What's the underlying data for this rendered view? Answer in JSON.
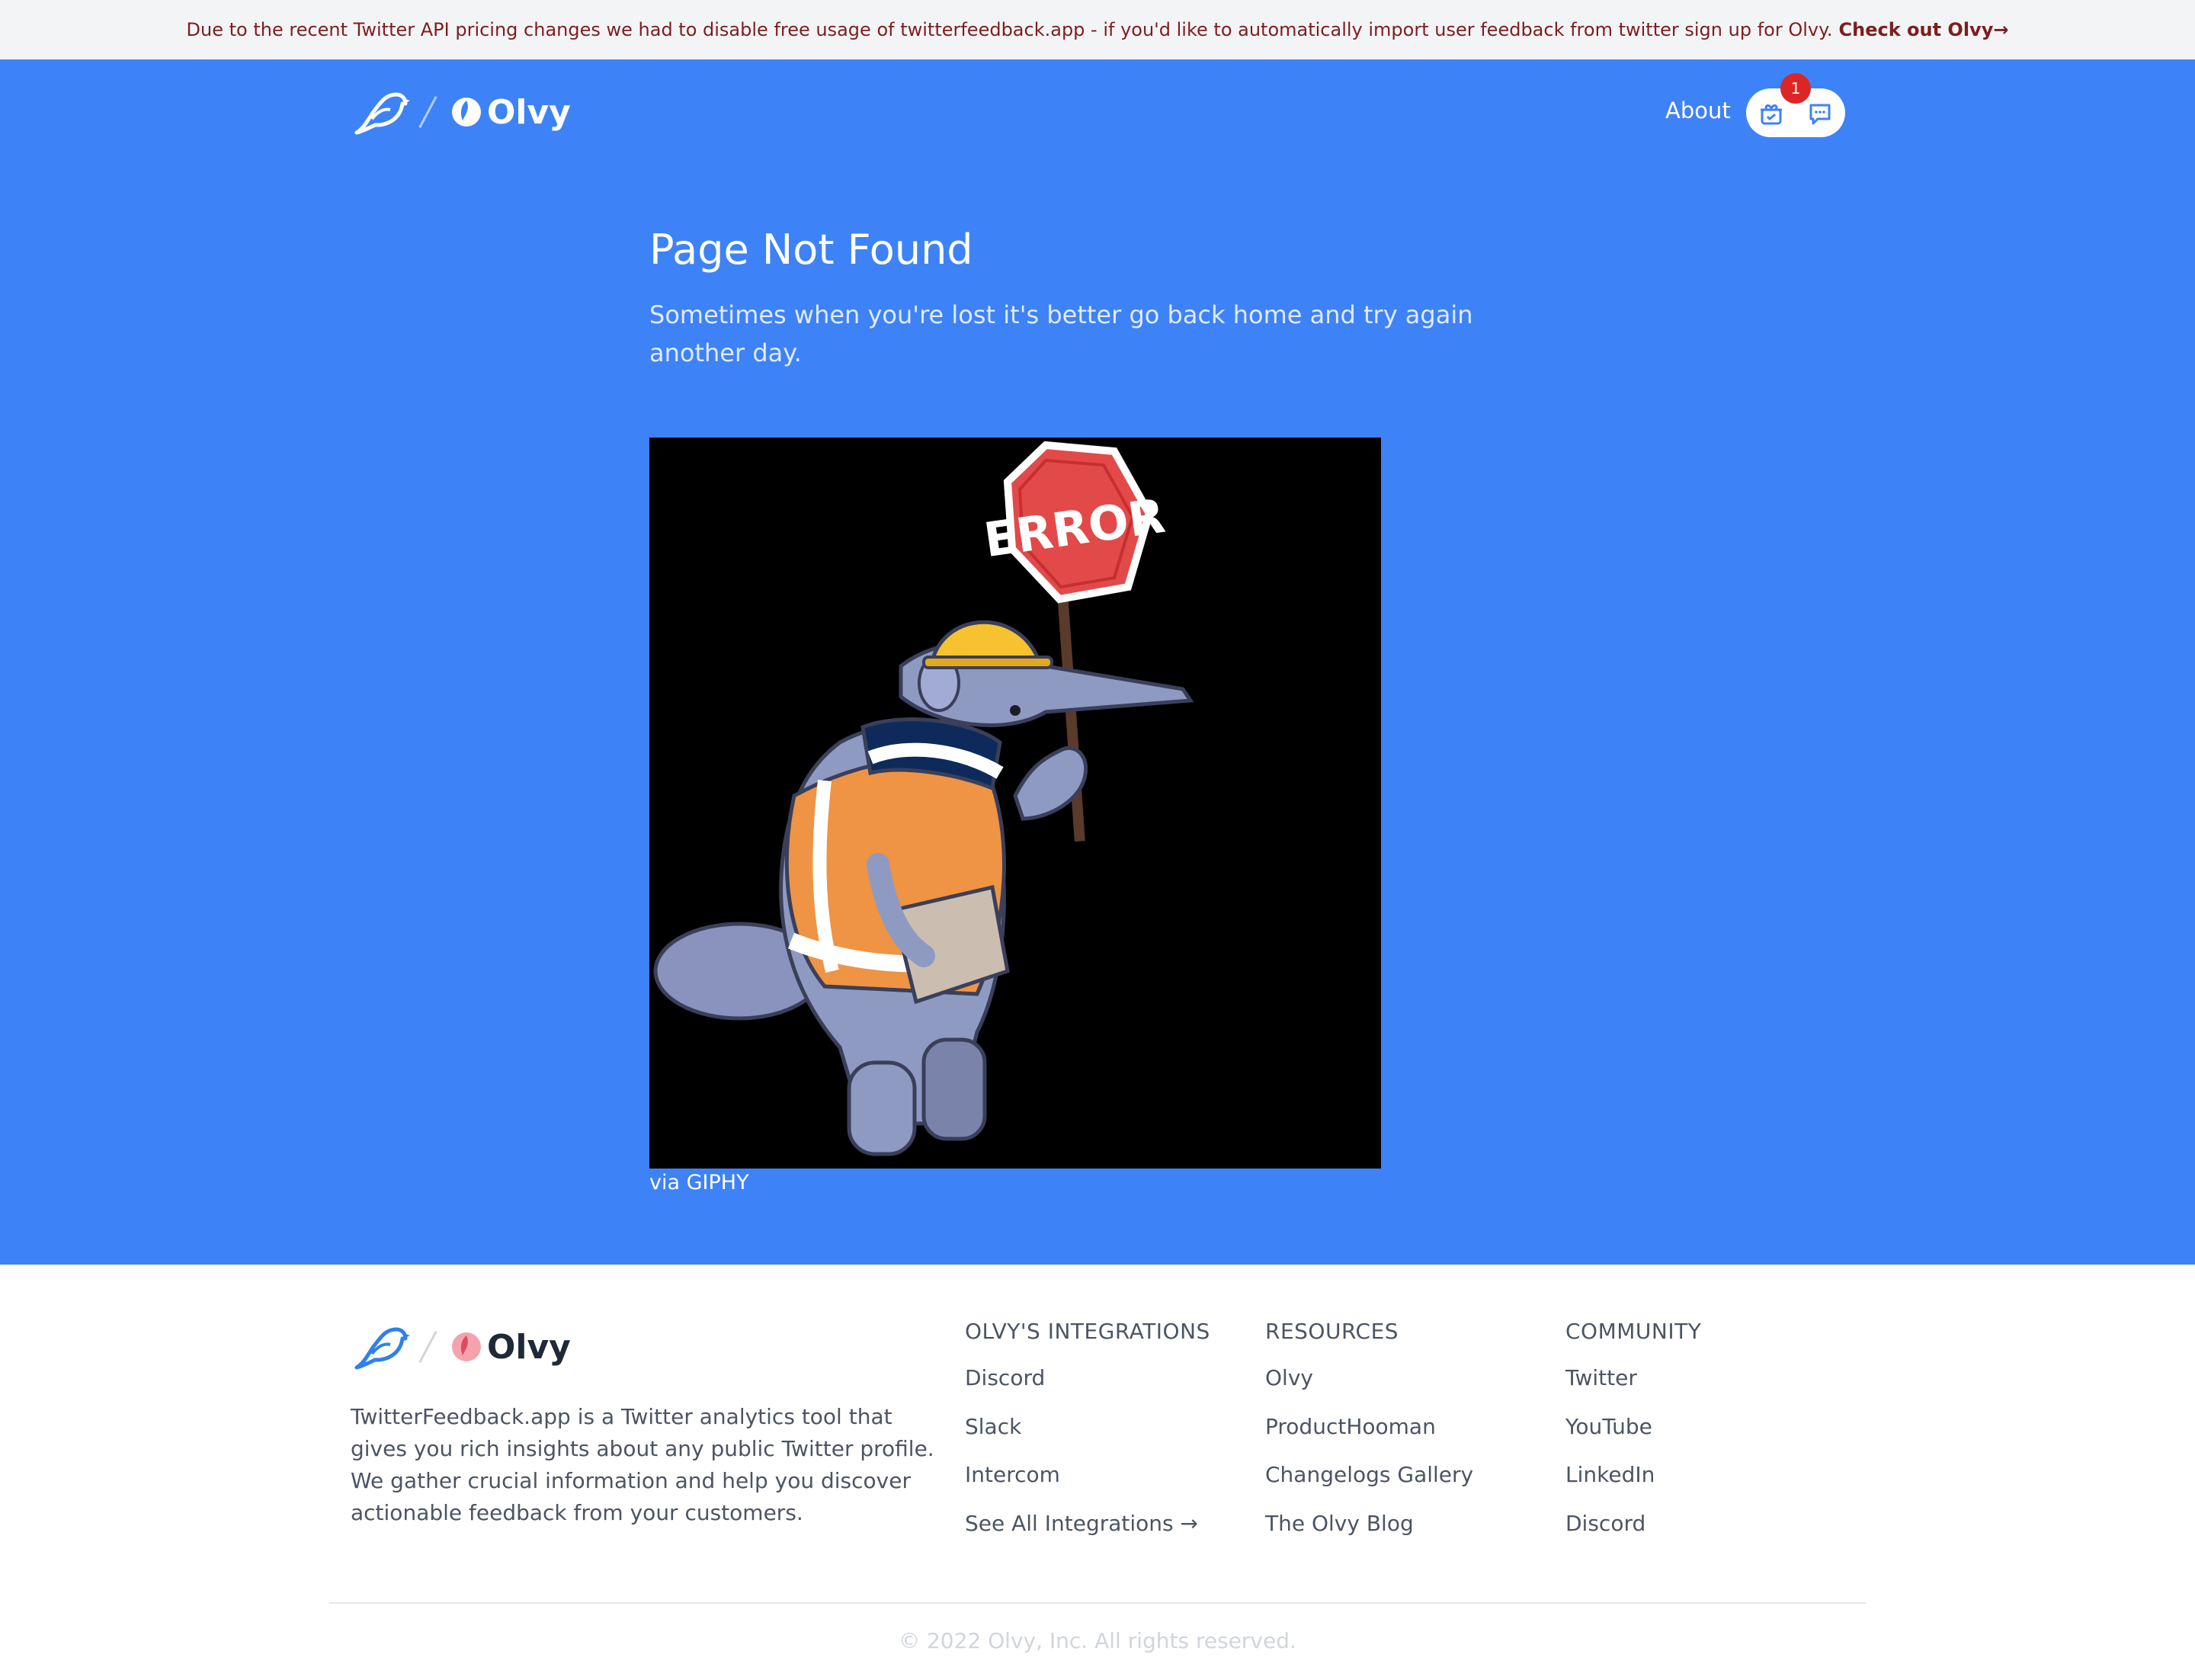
{
  "banner": {
    "text": "Due to the recent Twitter API pricing changes we had to disable free usage of twitterfeedback.app - if you'd like to automatically import user feedback from twitter sign up for Olvy.",
    "link": "Check out Olvy→"
  },
  "header": {
    "brand_name": "Olvy",
    "nav_about": "About",
    "notification_count": "1",
    "icons": [
      "bird-logo-icon",
      "olvy-logo-icon",
      "gift-icon",
      "chat-icon"
    ]
  },
  "main": {
    "title": "Page Not Found",
    "subtitle": "Sometimes when you're lost it's better go back home and try again another day.",
    "gif_sign_text": "ERROR",
    "gif_caption": "via GIPHY"
  },
  "footer": {
    "brand_name": "Olvy",
    "description": "TwitterFeedback.app is a Twitter analytics tool that gives you rich insights about any public Twitter profile. We gather crucial information and help you discover actionable feedback from your customers.",
    "columns": [
      {
        "heading": "OLVY'S INTEGRATIONS",
        "links": [
          "Discord",
          "Slack",
          "Intercom",
          "See All Integrations →"
        ]
      },
      {
        "heading": "RESOURCES",
        "links": [
          "Olvy",
          "ProductHooman",
          "Changelogs Gallery",
          "The Olvy Blog"
        ]
      },
      {
        "heading": "COMMUNITY",
        "links": [
          "Twitter",
          "YouTube",
          "LinkedIn",
          "Discord"
        ]
      }
    ],
    "copyright": "© 2022 Olvy, Inc. All rights reserved."
  },
  "colors": {
    "hero_blue": "#3e82f7",
    "banner_text": "#7f1d1d",
    "badge_red": "#dc2626",
    "footer_bird_blue": "#2f80ed",
    "olvy_logo_red": "#e04a5f"
  }
}
